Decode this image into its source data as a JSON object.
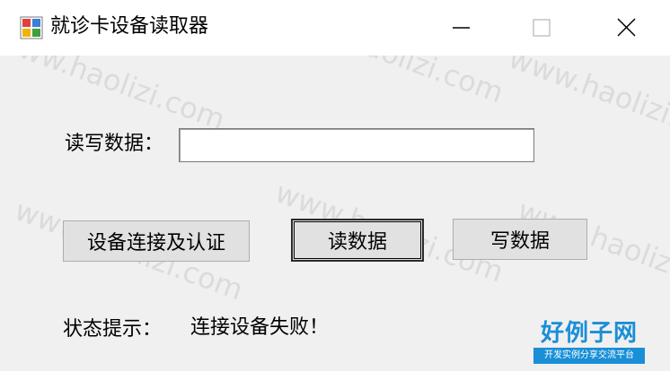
{
  "window": {
    "title": "就诊卡设备读取器",
    "minimize_icon": "minimize-icon",
    "maximize_icon": "maximize-icon",
    "close_icon": "close-icon"
  },
  "form": {
    "read_write_label": "读写数据：",
    "data_input_value": "",
    "connect_button": "设备连接及认证",
    "read_button": "读数据",
    "write_button": "写数据",
    "status_label": "状态提示：",
    "status_value": "连接设备失败！"
  },
  "watermark": {
    "text": "www.haolizi.com"
  },
  "logo": {
    "main": "好例子网",
    "sub": "开发实例分享交流平台"
  }
}
